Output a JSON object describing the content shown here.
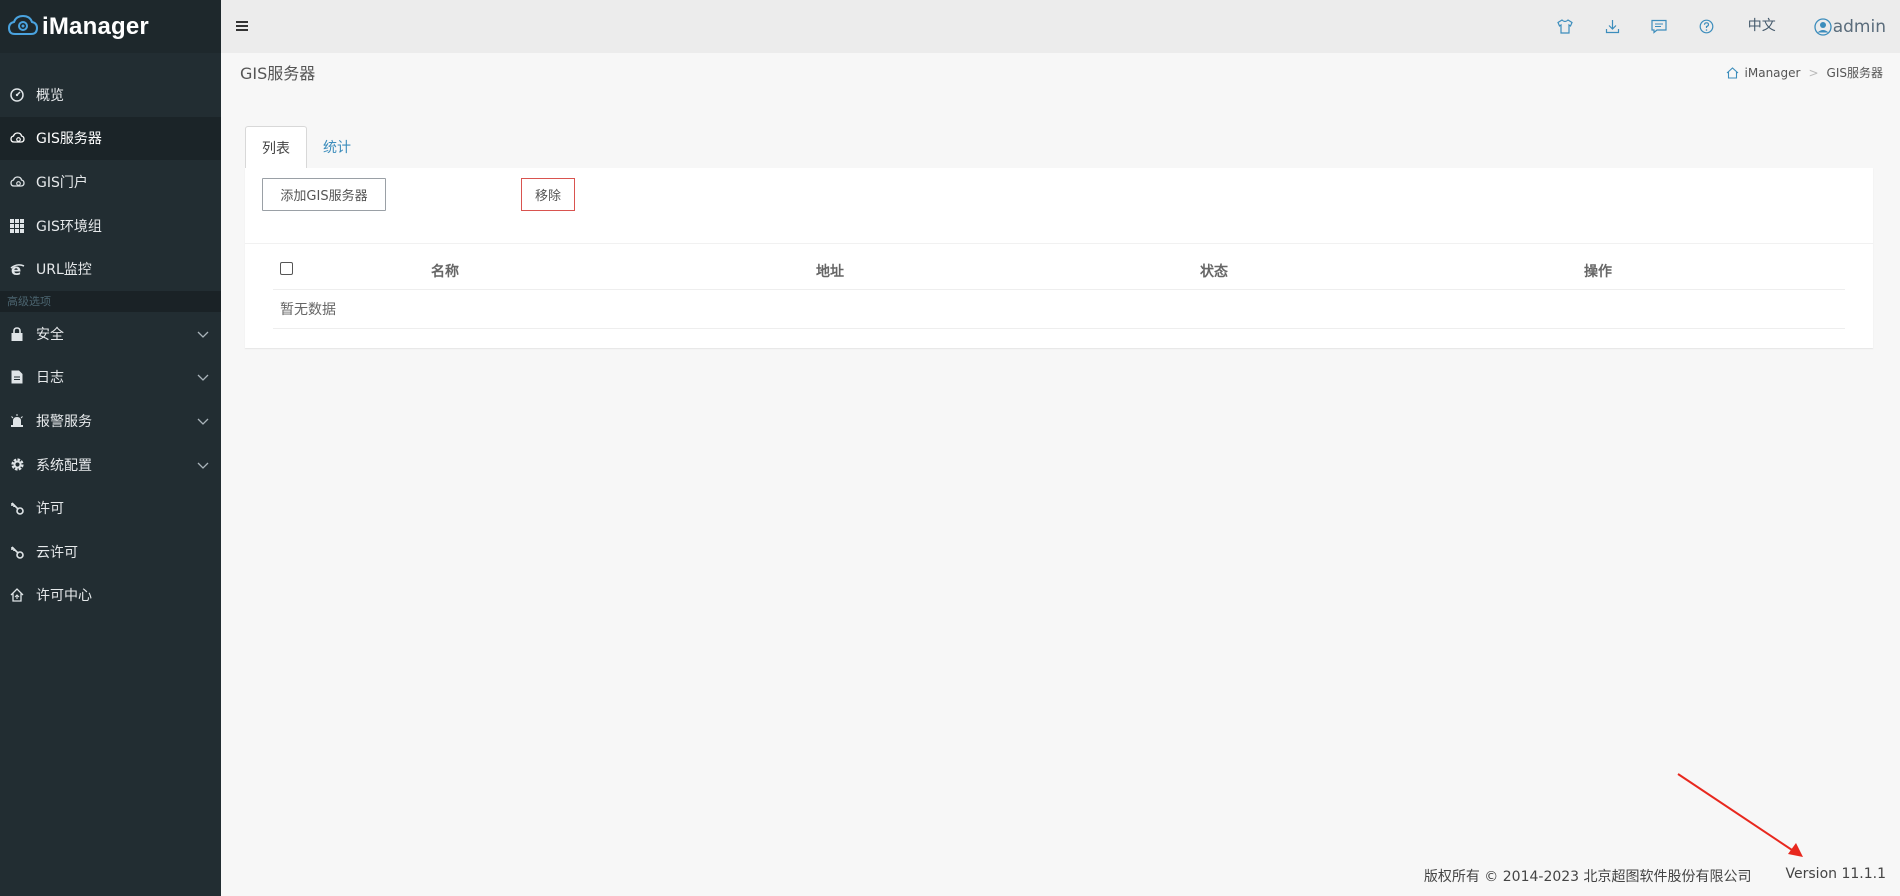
{
  "app": {
    "name": "iManager"
  },
  "sidebar": {
    "items": [
      {
        "label": "概览",
        "icon": "dashboard-icon"
      },
      {
        "label": "GIS服务器",
        "icon": "cloud-gear-icon",
        "active": true
      },
      {
        "label": "GIS门户",
        "icon": "cloud-gear-icon"
      },
      {
        "label": "GIS环境组",
        "icon": "grid-icon"
      },
      {
        "label": "URL监控",
        "icon": "ie-icon"
      }
    ],
    "section_header": "高级选项",
    "advanced": [
      {
        "label": "安全",
        "icon": "lock-icon",
        "expandable": true
      },
      {
        "label": "日志",
        "icon": "file-icon",
        "expandable": true
      },
      {
        "label": "报警服务",
        "icon": "alarm-icon",
        "expandable": true
      },
      {
        "label": "系统配置",
        "icon": "gear-icon",
        "expandable": true
      },
      {
        "label": "许可",
        "icon": "key-icon"
      },
      {
        "label": "云许可",
        "icon": "key-icon"
      },
      {
        "label": "许可中心",
        "icon": "home-up-icon"
      }
    ]
  },
  "topbar": {
    "icons": [
      "shirt-icon",
      "download-icon",
      "message-icon",
      "help-icon"
    ],
    "language": "中文",
    "user": "admin"
  },
  "page": {
    "title": "GIS服务器",
    "breadcrumb": [
      "iManager",
      "GIS服务器"
    ]
  },
  "tabs": [
    {
      "label": "列表",
      "active": true
    },
    {
      "label": "统计"
    }
  ],
  "toolbar": {
    "add_label": "添加GIS服务器",
    "remove_label": "移除"
  },
  "table": {
    "columns": [
      "名称",
      "地址",
      "状态",
      "操作"
    ],
    "empty_text": "暂无数据"
  },
  "footer": {
    "copyright": "版权所有 © 2014-2023 北京超图软件股份有限公司",
    "version": "Version 11.1.1"
  },
  "colors": {
    "sidebar_bg": "#222d32",
    "link": "#3c8dbc",
    "danger": "#d9534f",
    "annotation_arrow": "#e8281e"
  }
}
